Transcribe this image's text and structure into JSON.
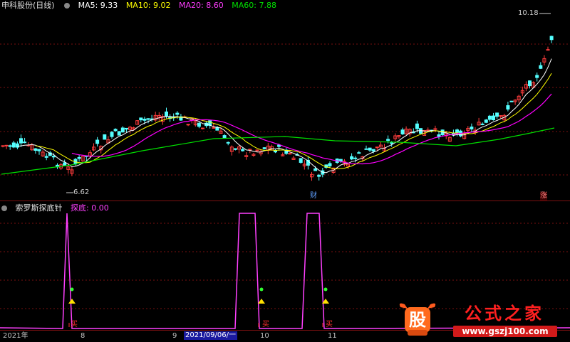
{
  "main_header": {
    "title": "申科股份(日线)",
    "ma5": "MA5: 9.33",
    "ma10": "MA10: 9.02",
    "ma20": "MA20: 8.60",
    "ma60": "MA60: 7.88"
  },
  "main_panel": {
    "high_label": "10.18",
    "low_label": "6.62",
    "marker_cai": "财",
    "marker_zhang": "涨"
  },
  "sub_header": {
    "title": "索罗斯探底针",
    "value": "探底: 0.00"
  },
  "sub_panel": {
    "buy_label": "买",
    "buy_marks": 3
  },
  "axis": {
    "labels": [
      "2021年",
      "8",
      "9",
      "2021/09/06/一",
      "10",
      "11"
    ]
  },
  "watermark": {
    "logo_text": "股",
    "brand": "公式之家",
    "url": "www.gszj100.com"
  },
  "colors": {
    "background": "#000000",
    "up": "#ff3c3c",
    "down": "#54ffff",
    "ma5": "#ffffff",
    "ma10": "#ffff00",
    "ma20": "#ff00ff",
    "ma60": "#00e000",
    "indicator": "#ff40ff",
    "grid": "#7a1010"
  },
  "chart_data": [
    {
      "type": "line",
      "title": "申科股份(日线)",
      "series": [
        {
          "name": "MA5",
          "last": 9.33
        },
        {
          "name": "MA10",
          "last": 9.02
        },
        {
          "name": "MA20",
          "last": 8.6
        },
        {
          "name": "MA60",
          "last": 7.88
        }
      ],
      "annotations": [
        {
          "text": "10.18",
          "note": "period high"
        },
        {
          "text": "6.62",
          "note": "period low"
        }
      ],
      "x_tick_labels": [
        "2021年",
        "8",
        "9",
        "2021/09/06/一",
        "10",
        "11"
      ]
    },
    {
      "type": "line",
      "title": "索罗斯探底针",
      "series": [
        {
          "name": "探底",
          "last": 0.0
        }
      ],
      "spikes": 3,
      "signal_text": "买"
    }
  ]
}
